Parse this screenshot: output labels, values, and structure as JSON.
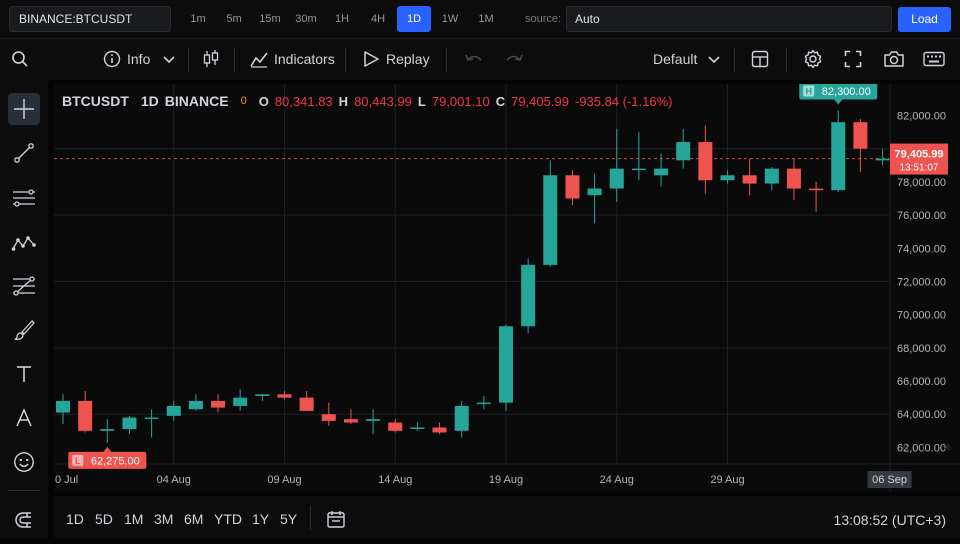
{
  "topbar": {
    "symbol": "BINANCE:BTCUSDT",
    "intervals": [
      "1m",
      "5m",
      "15m",
      "30m",
      "1H",
      "4H",
      "1D",
      "1W",
      "1M"
    ],
    "active_interval": "1D",
    "source_label": "source:",
    "source_value": "Auto",
    "load_label": "Load"
  },
  "toolbar": {
    "info_label": "Info",
    "indicators_label": "Indicators",
    "replay_label": "Replay",
    "layout_label": "Default"
  },
  "legend": {
    "symbol": "BTCUSDT",
    "interval": "1D",
    "exchange": "BINANCE",
    "status": "0",
    "o_label": "O",
    "o": "80,341.83",
    "h_label": "H",
    "h": "80,443.99",
    "l_label": "L",
    "l": "79,001.10",
    "c_label": "C",
    "c": "79,405.99",
    "change": "-935.84 (-1.16%)"
  },
  "markers": {
    "high_tag": "H",
    "high_value": "82,300.00",
    "low_tag": "L",
    "low_value": "62,275.00",
    "last_price": "79,405.99",
    "countdown": "13:51:07",
    "scale_buttons": [
      "A",
      "L",
      "%"
    ]
  },
  "bottombar": {
    "ranges": [
      "1D",
      "5D",
      "1M",
      "3M",
      "6M",
      "YTD",
      "1Y",
      "5Y"
    ],
    "clock": "13:08:52 (UTC+3)"
  },
  "colors": {
    "up": "#26a69a",
    "down": "#ef5350",
    "accent": "#2962ff"
  },
  "chart_data": {
    "type": "candlestick",
    "title": "",
    "y_ticks": [
      62000,
      64000,
      66000,
      68000,
      70000,
      72000,
      74000,
      76000,
      78000,
      80000,
      82000
    ],
    "y_tick_labels": [
      "62,000.00",
      "64,000.00",
      "66,000.00",
      "68,000.00",
      "70,000.00",
      "72,000.00",
      "74,000.00",
      "76,000.00",
      "78,000.00",
      "80,000.00",
      "82,000.00"
    ],
    "ylim": [
      61000,
      83900
    ],
    "x_ticks": [
      {
        "label": "0 Jul",
        "index": -0.2
      },
      {
        "label": "04 Aug",
        "index": 5
      },
      {
        "label": "09 Aug",
        "index": 10
      },
      {
        "label": "14 Aug",
        "index": 15
      },
      {
        "label": "19 Aug",
        "index": 20
      },
      {
        "label": "24 Aug",
        "index": 25
      },
      {
        "label": "29 Aug",
        "index": 30
      }
    ],
    "crosshair_label": "06 Sep",
    "crosshair_index": 37,
    "grid": true,
    "last_price": 79405.99,
    "candles": [
      {
        "o": 64100,
        "h": 65200,
        "l": 63400,
        "c": 64800
      },
      {
        "o": 64800,
        "h": 65400,
        "l": 62900,
        "c": 63000
      },
      {
        "o": 63000,
        "h": 63700,
        "l": 62275,
        "c": 63100
      },
      {
        "o": 63100,
        "h": 63900,
        "l": 62800,
        "c": 63800
      },
      {
        "o": 63800,
        "h": 64300,
        "l": 62600,
        "c": 63800
      },
      {
        "o": 63900,
        "h": 64800,
        "l": 63600,
        "c": 64500
      },
      {
        "o": 64300,
        "h": 65200,
        "l": 64200,
        "c": 64800
      },
      {
        "o": 64800,
        "h": 65200,
        "l": 64100,
        "c": 64400
      },
      {
        "o": 64500,
        "h": 65500,
        "l": 64200,
        "c": 65000
      },
      {
        "o": 65100,
        "h": 65200,
        "l": 64800,
        "c": 65200
      },
      {
        "o": 65200,
        "h": 65400,
        "l": 64900,
        "c": 65000
      },
      {
        "o": 65000,
        "h": 65400,
        "l": 64200,
        "c": 64200
      },
      {
        "o": 64000,
        "h": 64700,
        "l": 63300,
        "c": 63600
      },
      {
        "o": 63700,
        "h": 64300,
        "l": 63400,
        "c": 63500
      },
      {
        "o": 63600,
        "h": 64300,
        "l": 62800,
        "c": 63700
      },
      {
        "o": 63500,
        "h": 63700,
        "l": 62900,
        "c": 63000
      },
      {
        "o": 63200,
        "h": 63500,
        "l": 63000,
        "c": 63200
      },
      {
        "o": 63200,
        "h": 63500,
        "l": 62800,
        "c": 62900
      },
      {
        "o": 63000,
        "h": 64800,
        "l": 62600,
        "c": 64500
      },
      {
        "o": 64700,
        "h": 65100,
        "l": 64300,
        "c": 64700
      },
      {
        "o": 64700,
        "h": 69400,
        "l": 64200,
        "c": 69300
      },
      {
        "o": 69300,
        "h": 73400,
        "l": 68900,
        "c": 73000
      },
      {
        "o": 73000,
        "h": 79300,
        "l": 72900,
        "c": 78400
      },
      {
        "o": 78400,
        "h": 78700,
        "l": 76600,
        "c": 77000
      },
      {
        "o": 77200,
        "h": 78500,
        "l": 75500,
        "c": 77600
      },
      {
        "o": 77600,
        "h": 81200,
        "l": 76800,
        "c": 78800
      },
      {
        "o": 78800,
        "h": 81000,
        "l": 78100,
        "c": 78800
      },
      {
        "o": 78400,
        "h": 79700,
        "l": 77700,
        "c": 78800
      },
      {
        "o": 79300,
        "h": 81200,
        "l": 78800,
        "c": 80400
      },
      {
        "o": 80400,
        "h": 81400,
        "l": 77300,
        "c": 78100
      },
      {
        "o": 78100,
        "h": 78700,
        "l": 77900,
        "c": 78400
      },
      {
        "o": 78400,
        "h": 79400,
        "l": 77200,
        "c": 77900
      },
      {
        "o": 77900,
        "h": 78900,
        "l": 77500,
        "c": 78800
      },
      {
        "o": 78800,
        "h": 79400,
        "l": 76900,
        "c": 77600
      },
      {
        "o": 77600,
        "h": 78000,
        "l": 76200,
        "c": 77500
      },
      {
        "o": 77500,
        "h": 82300,
        "l": 77400,
        "c": 81600
      },
      {
        "o": 81600,
        "h": 81800,
        "l": 78600,
        "c": 80000
      },
      {
        "o": 79300,
        "h": 80000,
        "l": 79000,
        "c": 79400
      }
    ]
  }
}
